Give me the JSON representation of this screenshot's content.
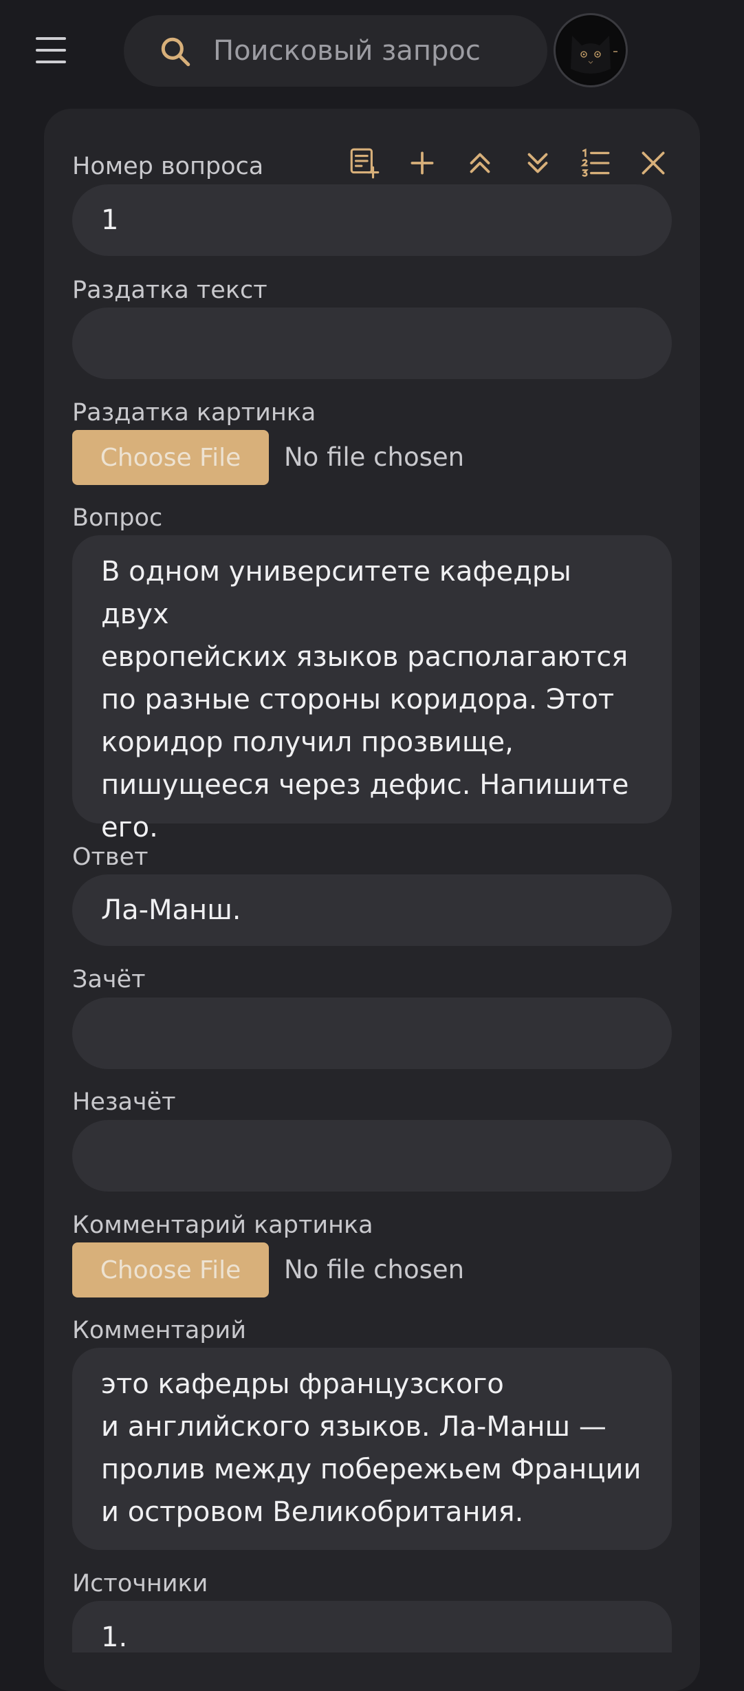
{
  "header": {
    "search_placeholder": "Поисковый запрос"
  },
  "colors": {
    "accent": "#d8b07a",
    "background": "#1b1b1f",
    "card": "#252529",
    "input": "#313136"
  },
  "toolbar": {
    "icons": [
      "add-note-icon",
      "plus-icon",
      "chevrons-up-icon",
      "chevrons-down-icon",
      "numbered-list-icon",
      "close-icon"
    ]
  },
  "form": {
    "question_number": {
      "label": "Номер вопроса",
      "value": "1"
    },
    "handout_text": {
      "label": "Раздатка текст",
      "value": ""
    },
    "handout_image": {
      "label": "Раздатка картинка",
      "button": "Choose File",
      "status": "No file chosen"
    },
    "question": {
      "label": "Вопрос",
      "value": "В одном университете кафедры двух\nевропейских языков располагаются\nпо разные стороны коридора. Этот\nкоридор получил прозвище,\nпишущееся через дефис. Напишите\nего."
    },
    "answer": {
      "label": "Ответ",
      "value": "Ла-Манш."
    },
    "accepted": {
      "label": "Зачёт",
      "value": ""
    },
    "not_accepted": {
      "label": "Незачёт",
      "value": ""
    },
    "comment_image": {
      "label": "Комментарий картинка",
      "button": "Choose File",
      "status": "No file chosen"
    },
    "comment": {
      "label": "Комментарий",
      "value": "это кафедры французского\nи английского языков. Ла-Манш —\nпролив между побережьем Франции\nи островом Великобритания."
    },
    "sources": {
      "label": "Источники",
      "value": "1."
    }
  }
}
